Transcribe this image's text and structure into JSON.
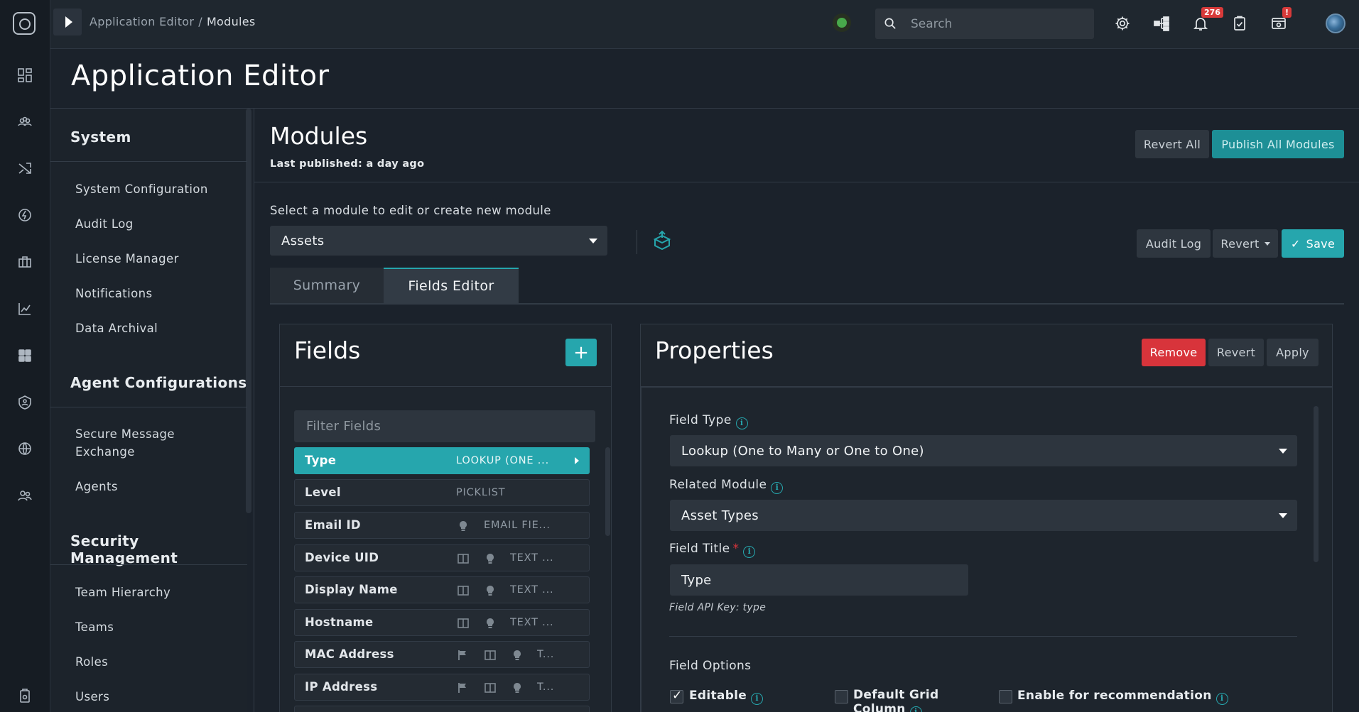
{
  "breadcrumb": {
    "parent": "Application Editor",
    "separator": "/",
    "current": "Modules"
  },
  "search": {
    "placeholder": "Search"
  },
  "notifications": {
    "count": "276"
  },
  "system_alert": {
    "badge": "!"
  },
  "page": {
    "title": "Application Editor"
  },
  "sidebar": {
    "sections": [
      {
        "title": "System",
        "items": [
          "System Configuration",
          "Audit Log",
          "License Manager",
          "Notifications",
          "Data Archival"
        ]
      },
      {
        "title": "Agent Configurations",
        "items": [
          "Secure Message Exchange",
          "Agents"
        ]
      },
      {
        "title": "Security Management",
        "items": [
          "Team Hierarchy",
          "Teams",
          "Roles",
          "Users"
        ]
      }
    ]
  },
  "modules": {
    "title": "Modules",
    "last_published": "Last published: a day ago",
    "revert_all": "Revert All",
    "publish_all": "Publish All Modules",
    "select_label": "Select a module to edit or create new module",
    "selected_module": "Assets",
    "audit_log": "Audit Log",
    "revert": "Revert",
    "save": "Save"
  },
  "tabs": [
    {
      "label": "Summary",
      "active": false
    },
    {
      "label": "Fields Editor",
      "active": true
    }
  ],
  "fields_panel": {
    "title": "Fields",
    "add": "+",
    "filter_placeholder": "Filter Fields",
    "rows": [
      {
        "name": "Type",
        "type": "LOOKUP (ONE ...",
        "active": true,
        "icons": []
      },
      {
        "name": "Level",
        "type": "PICKLIST",
        "icons": []
      },
      {
        "name": "Email ID",
        "type": "EMAIL FIE...",
        "icons": [
          "bulb-icon"
        ]
      },
      {
        "name": "Device UID",
        "type": "TEXT ...",
        "icons": [
          "columns-icon",
          "bulb-icon"
        ]
      },
      {
        "name": "Display Name",
        "type": "TEXT ...",
        "icons": [
          "columns-icon",
          "bulb-icon"
        ]
      },
      {
        "name": "Hostname",
        "type": "TEXT ...",
        "icons": [
          "columns-icon",
          "bulb-icon"
        ]
      },
      {
        "name": "MAC Address",
        "type": "T...",
        "icons": [
          "flag-icon",
          "columns-icon",
          "bulb-icon"
        ]
      },
      {
        "name": "IP Address",
        "type": "T...",
        "icons": [
          "flag-icon",
          "columns-icon",
          "bulb-icon"
        ]
      }
    ]
  },
  "properties": {
    "title": "Properties",
    "remove": "Remove",
    "revert": "Revert",
    "apply": "Apply",
    "field_type_label": "Field Type",
    "field_type_value": "Lookup (One to Many or One to One)",
    "related_module_label": "Related Module",
    "related_module_value": "Asset Types",
    "field_title_label": "Field Title",
    "required_mark": "*",
    "field_title_value": "Type",
    "api_key": "Field API Key: type",
    "options_label": "Field Options",
    "options": [
      {
        "label": "Editable",
        "checked": true
      },
      {
        "label": "Default Grid Column",
        "checked": false
      },
      {
        "label": "Enable for recommendation",
        "checked": false
      }
    ]
  },
  "colors": {
    "accent": "#26a6ad",
    "danger": "#d8343b",
    "background": "#1b222b"
  }
}
